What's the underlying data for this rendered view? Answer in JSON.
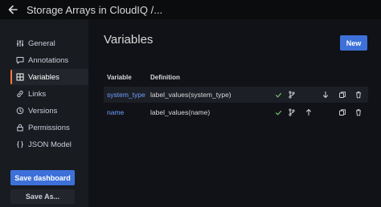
{
  "topbar": {
    "title": "Storage Arrays in CloudIQ /..."
  },
  "sidebar": {
    "items": [
      {
        "label": "General",
        "icon": "sliders-icon"
      },
      {
        "label": "Annotations",
        "icon": "comment-icon"
      },
      {
        "label": "Variables",
        "icon": "calculator-icon"
      },
      {
        "label": "Links",
        "icon": "link-icon"
      },
      {
        "label": "Versions",
        "icon": "history-icon"
      },
      {
        "label": "Permissions",
        "icon": "lock-icon"
      },
      {
        "label": "JSON Model",
        "icon": "braces-icon"
      }
    ],
    "active": "Variables",
    "save_dashboard_label": "Save dashboard",
    "save_as_label": "Save As..."
  },
  "main": {
    "title": "Variables",
    "new_button_label": "New",
    "columns": [
      "Variable",
      "Definition"
    ],
    "rows": [
      {
        "name": "system_type",
        "definition": "label_values(system_type)"
      },
      {
        "name": "name",
        "definition": "label_values(name)"
      }
    ]
  },
  "colors": {
    "background": "#111217",
    "sidebar": "#181b1f",
    "primary": "#3d71d9",
    "link": "#6e9fff",
    "active_marker": "#ff7941",
    "check": "#73bf69"
  }
}
